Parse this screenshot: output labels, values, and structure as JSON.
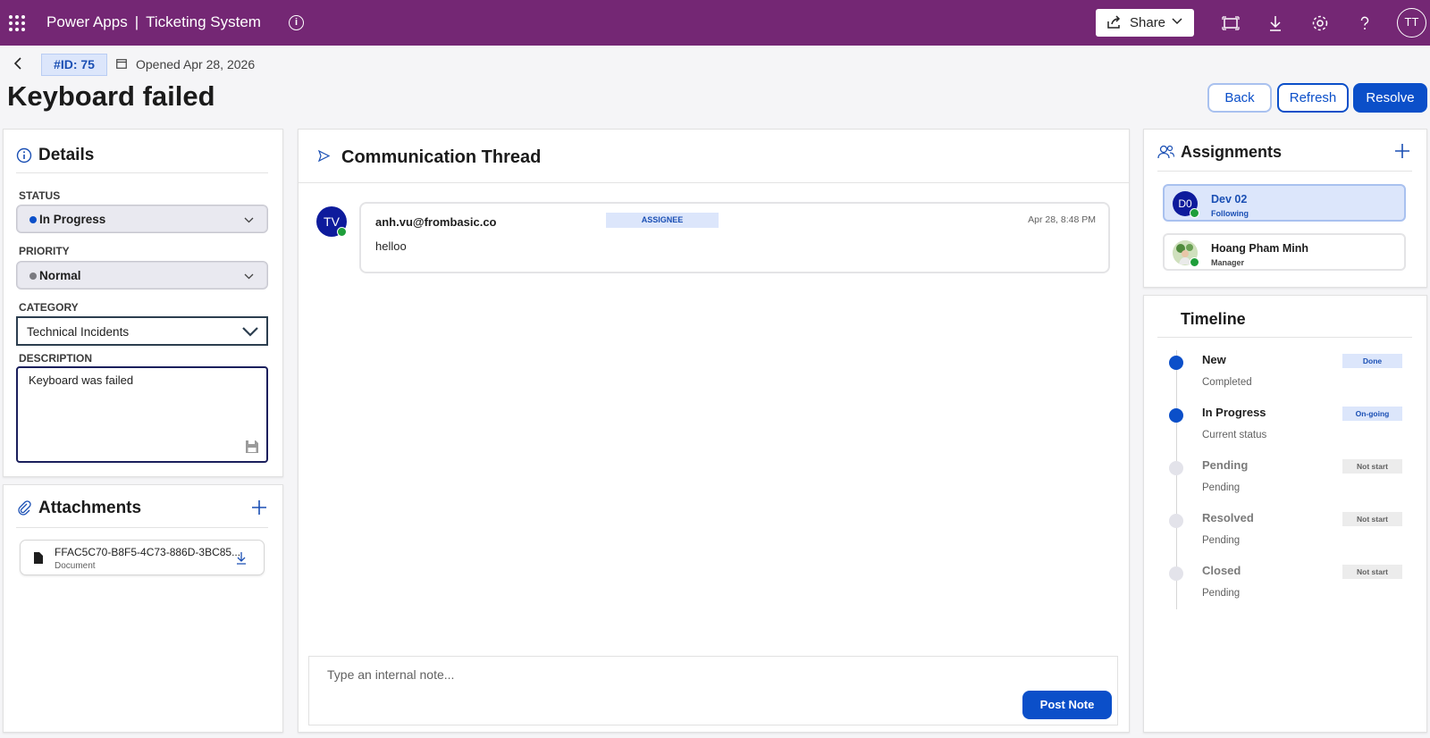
{
  "topbar": {
    "app_name": "Power Apps",
    "separator": "|",
    "app_title": "Ticketing System",
    "share_label": "Share",
    "user_initials": "TT",
    "icons": [
      "waffle-icon",
      "info-icon",
      "share-icon",
      "fit-screen-icon",
      "download-icon",
      "settings-icon",
      "help-icon"
    ],
    "bar_color": "#742774"
  },
  "header": {
    "ticket_id": "#ID: 75",
    "opened": "Opened Apr 28, 2026",
    "title": "Keyboard failed",
    "buttons": {
      "back": "Back",
      "refresh": "Refresh",
      "resolve": "Resolve"
    },
    "accent_color": "#0b4fc9"
  },
  "details": {
    "title": "Details",
    "status_label": "STATUS",
    "status_value": "In Progress",
    "priority_label": "PRIORITY",
    "priority_value": "Normal",
    "category_label": "CATEGORY",
    "category_value": "Technical Incidents",
    "description_label": "DESCRIPTION",
    "description_value": "Keyboard was failed"
  },
  "attachments": {
    "title": "Attachments",
    "items": [
      {
        "name": "FFAC5C70-B8F5-4C73-886D-3BC85...",
        "type": "Document"
      }
    ]
  },
  "thread": {
    "title": "Communication Thread",
    "messages": [
      {
        "initials": "TV",
        "from": "anh.vu@frombasic.co",
        "role": "ASSIGNEE",
        "time": "Apr 28, 8:48 PM",
        "body": "helloo"
      }
    ],
    "note_placeholder": "Type an internal note...",
    "post_label": "Post Note"
  },
  "assignments": {
    "title": "Assignments",
    "people": [
      {
        "initials": "D0",
        "name": "Dev 02",
        "role": "Following"
      },
      {
        "initials": "",
        "name": "Hoang Pham Minh",
        "role": "Manager"
      }
    ]
  },
  "timeline": {
    "title": "Timeline",
    "steps": [
      {
        "name": "New",
        "sub": "Completed",
        "badge": "Done"
      },
      {
        "name": "In Progress",
        "sub": "Current status",
        "badge": "On-going"
      },
      {
        "name": "Pending",
        "sub": "Pending",
        "badge": "Not start"
      },
      {
        "name": "Resolved",
        "sub": "Pending",
        "badge": "Not start"
      },
      {
        "name": "Closed",
        "sub": "Pending",
        "badge": "Not start"
      }
    ]
  }
}
